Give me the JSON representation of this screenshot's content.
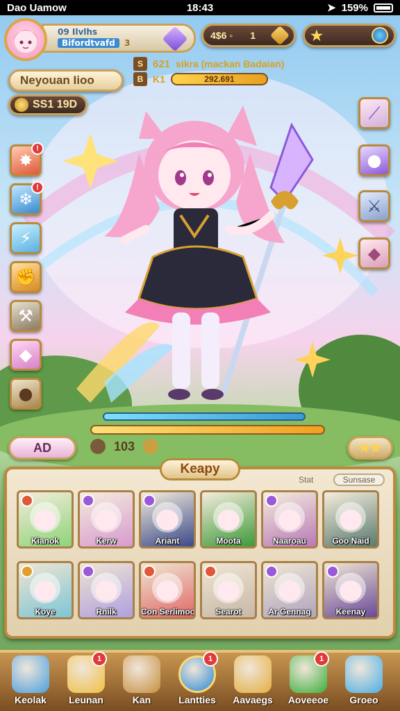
{
  "status_bar": {
    "carrier": "Dao Uamow",
    "time": "18:43",
    "battery": "159%"
  },
  "profile": {
    "line1": "09 Ilvlhs",
    "line2": "Bifordtvafd",
    "level_badge": "3"
  },
  "currency": {
    "primary_value": "1",
    "primary_prefix": "4$6 ◦",
    "secondary_label": ""
  },
  "info_lines": [
    {
      "icon_text": "S",
      "value": "621",
      "text": "sikra (mackan Badaian)"
    },
    {
      "icon_text": "B",
      "value": "K1",
      "bar_text": "292.691"
    }
  ],
  "nameplate": {
    "name": "Neyouan Iioo"
  },
  "gold": {
    "value": "SS1 19D"
  },
  "action_row": {
    "left_button": "AD",
    "mid_value": "103"
  },
  "panel": {
    "title": "Keapy",
    "sort_label": "Stat",
    "sort_value": "Sunsase"
  },
  "cards": [
    {
      "label": "Kianok",
      "rarity": "#e0583a",
      "bg": "#8fd47a"
    },
    {
      "label": "Kerw",
      "rarity": "#9a5ad8",
      "bg": "#d89bd0"
    },
    {
      "label": "Ariant",
      "rarity": "#9a5ad8",
      "bg": "#3b4a8a"
    },
    {
      "label": "Moota",
      "rarity": "",
      "bg": "#3e9a3a"
    },
    {
      "label": "Naaroau",
      "rarity": "#9a5ad8",
      "bg": "#b97ab8"
    },
    {
      "label": "Goo Naid",
      "rarity": "",
      "bg": "#5a7a70"
    },
    {
      "label": "Koye",
      "rarity": "#e0a030",
      "bg": "#7fc6d8"
    },
    {
      "label": "Rnilk",
      "rarity": "#9a5ad8",
      "bg": "#b0a0e0"
    },
    {
      "label": "Con Serlimoorg",
      "rarity": "#e0583a",
      "bg": "#e06a6a"
    },
    {
      "label": "Searot",
      "rarity": "#e0583a",
      "bg": "#c8b8a8"
    },
    {
      "label": "Ar Gennag",
      "rarity": "#9a5ad8",
      "bg": "#b0a6c0"
    },
    {
      "label": "Keenay",
      "rarity": "#9a5ad8",
      "bg": "#6a4a9a"
    }
  ],
  "nav": [
    {
      "label": "Keolak",
      "icon": "blue-crystal-icon",
      "color": "#4aa0e0",
      "badge": ""
    },
    {
      "label": "Leunan",
      "icon": "gold-star-icon",
      "color": "#f2c040",
      "badge": "1"
    },
    {
      "label": "Kan",
      "icon": "compass-icon",
      "color": "#c89040",
      "badge": ""
    },
    {
      "label": "Lantties",
      "icon": "play-icon",
      "color": "#2a8ad8",
      "badge": "1"
    },
    {
      "label": "Aavaegs",
      "icon": "scroll-icon",
      "color": "#e6b040",
      "badge": ""
    },
    {
      "label": "Aoveeoe",
      "icon": "green-orb-icon",
      "color": "#3ab03a",
      "badge": "1"
    },
    {
      "label": "Groeo",
      "icon": "flower-icon",
      "color": "#4ab0e8",
      "badge": ""
    }
  ]
}
